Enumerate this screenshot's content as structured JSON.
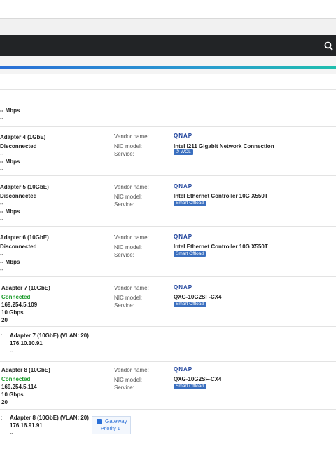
{
  "search": {
    "icon": "search-icon"
  },
  "top_partial": {
    "speed": "-- Mbps",
    "extra": "--"
  },
  "labels": {
    "vendor": "Vendor name:",
    "nic": "NIC model:",
    "service": "Service:"
  },
  "adapters": [
    {
      "name": "Adapter 4 (1GbE)",
      "status": "Disconnected",
      "ip": "--",
      "speed": "-- Mbps",
      "extra": "--",
      "vendor": "QNAP",
      "nic_model": "Intel I211 Gigabit Network Connection",
      "service_badge": "WOL"
    },
    {
      "name": "Adapter 5 (10GbE)",
      "status": "Disconnected",
      "ip": "--",
      "speed": "-- Mbps",
      "extra": "--",
      "vendor": "QNAP",
      "nic_model": "Intel Ethernet Controller 10G X550T",
      "service_badge": "Smart Offload"
    },
    {
      "name": "Adapter 6 (10GbE)",
      "status": "Disconnected",
      "ip": "--",
      "speed": "-- Mbps",
      "extra": "--",
      "vendor": "QNAP",
      "nic_model": "Intel Ethernet Controller 10G X550T",
      "service_badge": "Smart Offload"
    },
    {
      "name": "Adapter 7 (10GbE)",
      "status": "Connected",
      "ip": "169.254.5.109",
      "speed": "10 Gbps",
      "extra": "20",
      "vendor": "QNAP",
      "nic_model": "QXG-10G2SF-CX4",
      "service_badge": "Smart Offload",
      "vlan": {
        "prefix": ":",
        "name": "Adapter 7 (10GbE) (VLAN: 20)",
        "ip": "176.10.10.91",
        "extra": "--"
      }
    },
    {
      "name": "Adapter 8 (10GbE)",
      "status": "Connected",
      "ip": "169.254.5.114",
      "speed": "10 Gbps",
      "extra": "20",
      "vendor": "QNAP",
      "nic_model": "QXG-10G2SF-CX4",
      "service_badge": "Smart Offload",
      "vlan": {
        "prefix": ":",
        "name": "Adapter 8 (10GbE) (VLAN: 20)",
        "ip": "176.16.91.91",
        "extra": "--",
        "gateway": "Gateway",
        "priority": "Priority 1"
      }
    }
  ],
  "colors": {
    "accent": "#2a6fd6",
    "connected": "#1a9a2a",
    "badge": "#3a6fbf",
    "header": "#222426"
  }
}
